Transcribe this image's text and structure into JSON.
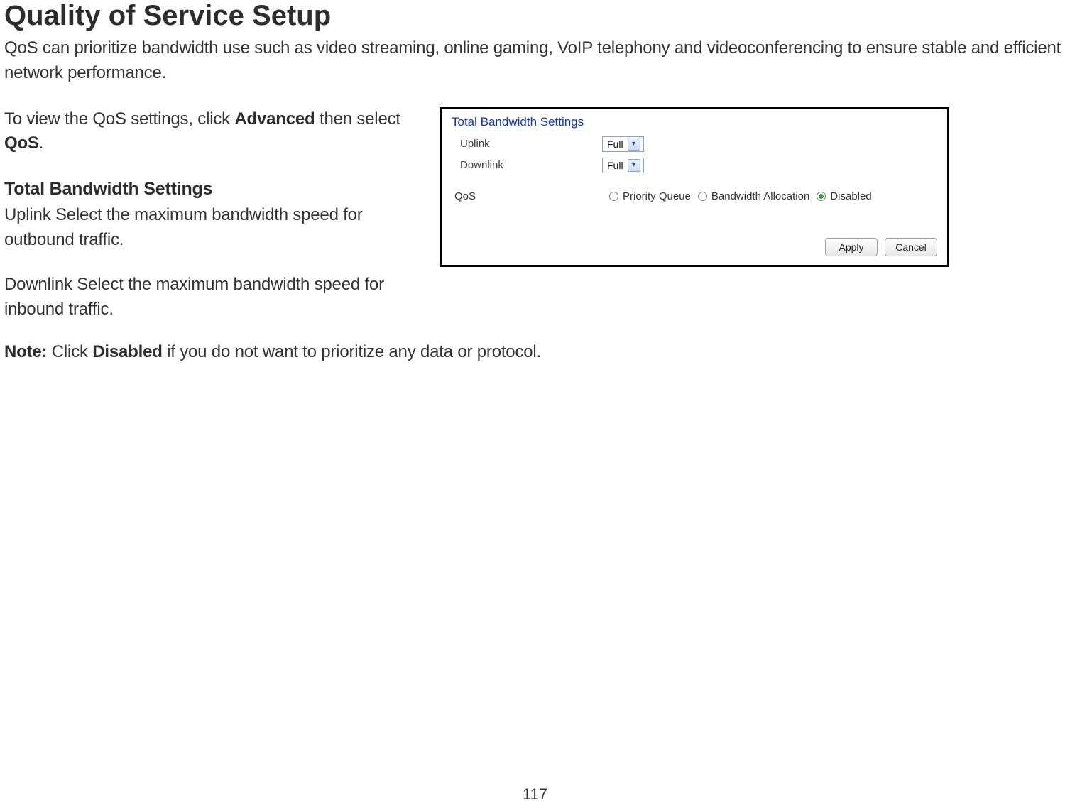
{
  "doc": {
    "title": "Quality of Service Setup",
    "intro": "QoS can prioritize bandwidth use such as video streaming, online gaming, VoIP telephony and videoconferencing to ensure stable and efficient network performance.",
    "view_prefix": "To view the QoS settings, click ",
    "view_bold1": "Advanced",
    "view_mid": " then select ",
    "view_bold2": "QoS",
    "view_suffix": ".",
    "subheading": "Total Bandwidth Settings",
    "uplink_text": "Uplink Select the maximum bandwidth speed for outbound traffic.",
    "downlink_text": "Downlink Select the maximum bandwidth speed for inbound traffic.",
    "note_bold": "Note:",
    "note_mid": " Click ",
    "note_bold2": "Disabled",
    "note_suffix": " if you do not want to prioritize any data or protocol.",
    "page_number": "117"
  },
  "panel": {
    "title": "Total Bandwidth Settings",
    "uplink_label": "Uplink",
    "uplink_value": "Full",
    "downlink_label": "Downlink",
    "downlink_value": "Full",
    "qos_label": "QoS",
    "radios": {
      "priority": "Priority Queue",
      "bandwidth": "Bandwidth Allocation",
      "disabled": "Disabled"
    },
    "selected_radio": "disabled",
    "apply_label": "Apply",
    "cancel_label": "Cancel"
  }
}
